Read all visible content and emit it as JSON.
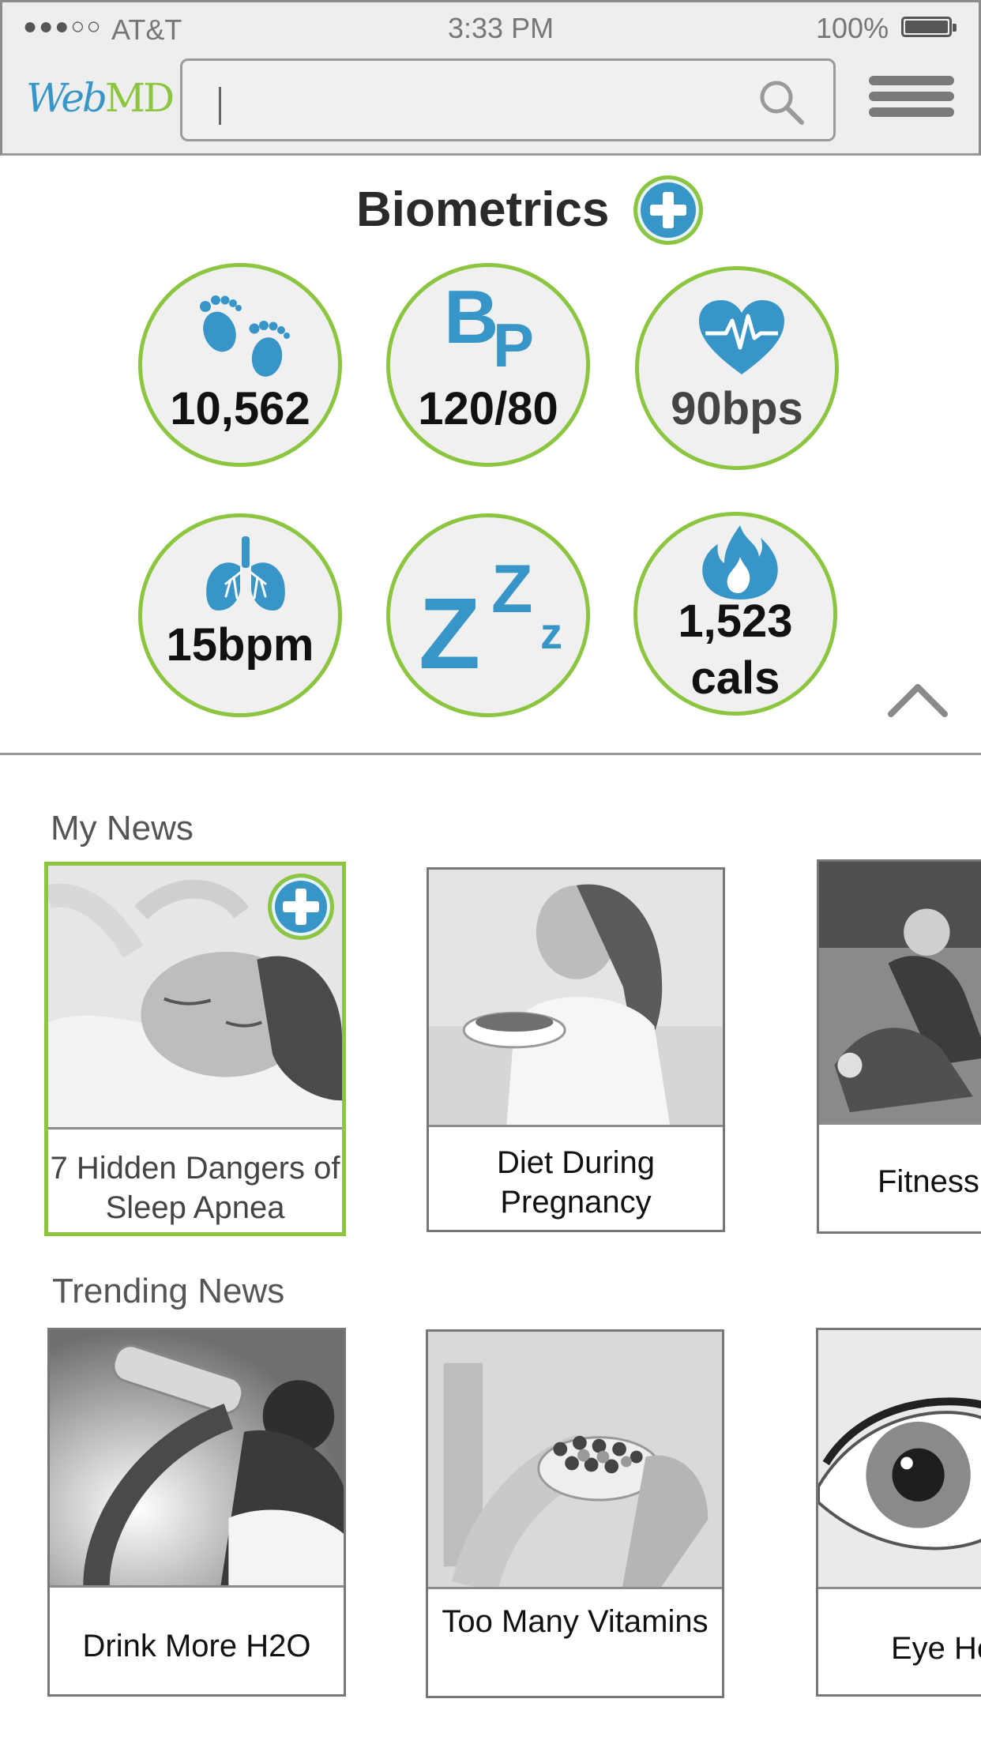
{
  "status": {
    "signal": "●●●○○",
    "carrier": "AT&T",
    "time": "3:33 PM",
    "battery": "100%"
  },
  "header": {
    "logo_web": "Web",
    "logo_md": "MD"
  },
  "biometrics": {
    "title": "Biometrics",
    "metrics": [
      {
        "icon": "footprints-icon",
        "value": "10,562"
      },
      {
        "icon": "blood-pressure-icon",
        "value": "120/80"
      },
      {
        "icon": "heart-rate-icon",
        "value": "90bps"
      },
      {
        "icon": "lungs-icon",
        "value": "15bpm"
      },
      {
        "icon": "sleep-icon",
        "value": ""
      },
      {
        "icon": "flame-icon",
        "value": "1,523",
        "value2": "cals"
      }
    ],
    "bp_icon_text": "BP",
    "sleep_text": {
      "big": "Z",
      "mid": "Z",
      "small": "z"
    }
  },
  "my_news": {
    "title": "My News",
    "items": [
      {
        "label": "7 Hidden Dangers of Sleep Apnea",
        "image": "sleeping man"
      },
      {
        "label": "Diet During Pregnancy",
        "image": "woman eating salad"
      },
      {
        "label": "Fitness",
        "image": "man stretching on field"
      }
    ]
  },
  "trending_news": {
    "title": "Trending News",
    "items": [
      {
        "label": "Drink More H2O",
        "image": "woman drinking water"
      },
      {
        "label": "Too Many Vitamins",
        "image": "hand holding pills"
      },
      {
        "label": "Eye Health",
        "image": "close-up eye"
      }
    ]
  },
  "colors": {
    "brand_blue": "#3796c7",
    "brand_green": "#8cc640"
  }
}
